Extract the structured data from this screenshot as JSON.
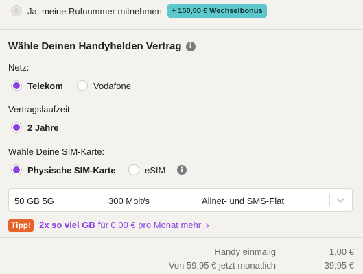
{
  "porting": {
    "label": "Ja, meine Rufnummer mitnehmen",
    "badge": "+ 150,00 € Wechselbonus"
  },
  "section": {
    "title": "Wähle Deinen Handyhelden Vertrag"
  },
  "netz": {
    "label": "Netz:",
    "options": [
      "Telekom",
      "Vodafone"
    ],
    "selected": "Telekom"
  },
  "laufzeit": {
    "label": "Vertragslaufzeit:",
    "options": [
      "2 Jahre"
    ],
    "selected": "2 Jahre"
  },
  "sim": {
    "label": "Wähle Deine SIM-Karte:",
    "options": [
      "Physische SIM-Karte",
      "eSIM"
    ],
    "selected": "Physische SIM-Karte"
  },
  "tariff_select": {
    "data": "50 GB 5G",
    "speed": "300 Mbit/s",
    "flat": "Allnet- und SMS-Flat"
  },
  "tip": {
    "badge": "Tipp!",
    "highlight": "2x so viel GB",
    "text": "für 0,00 € pro Monat mehr",
    "chevron": "›"
  },
  "summary": {
    "rows": [
      {
        "label": "Handy einmalig",
        "value": "1,00 €"
      },
      {
        "label": "Von 59,95 € jetzt monatlich",
        "value": "39,95 €"
      }
    ]
  },
  "colors": {
    "accent": "#8a3fe0",
    "badge_bg": "#5cc8cc",
    "tip_bg": "#e8632a",
    "page_bg": "#f4f2ee"
  }
}
